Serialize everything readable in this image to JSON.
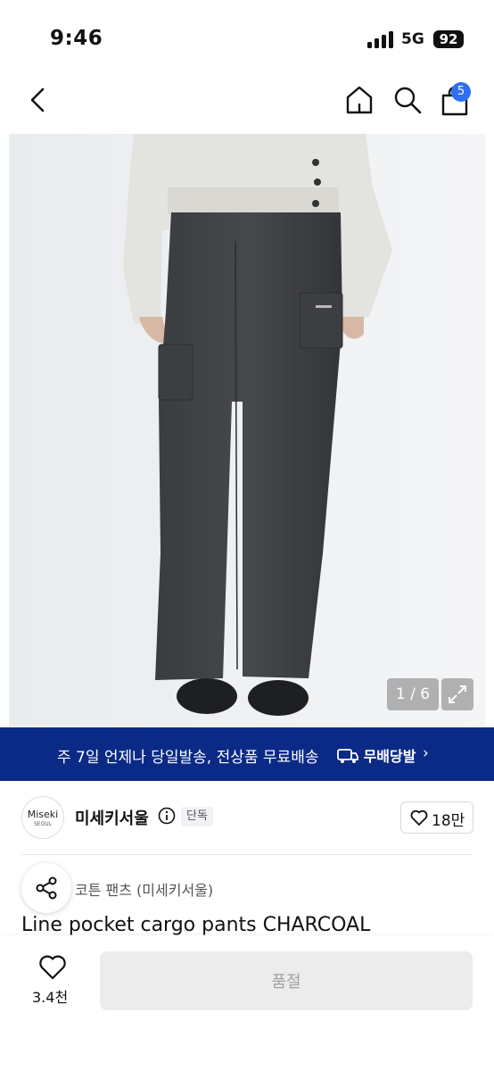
{
  "status_bar": {
    "time": "9:46",
    "network": "5G",
    "battery": "92"
  },
  "nav": {
    "cart_count": "5"
  },
  "gallery": {
    "counter": "1 / 6"
  },
  "banner": {
    "text": "주 7일 언제나 당일발송, 전상품 무료배송",
    "logo_text": "무배당발",
    "chevron": "›"
  },
  "brand": {
    "logo_line1": "Miseki",
    "logo_line2": "SEOUL",
    "name": "미세키서울",
    "badge": "단독",
    "likes": "18만"
  },
  "product": {
    "category": "코튼 팬츠 (미세키서울)",
    "title": "Line pocket cargo pants CHARCOAL"
  },
  "bottom": {
    "wish_count": "3.4천",
    "button_label": "품절"
  },
  "colors": {
    "accent": "#2f6ff5",
    "banner_bg": "#0a2a86",
    "button_disabled": "#ececec"
  }
}
